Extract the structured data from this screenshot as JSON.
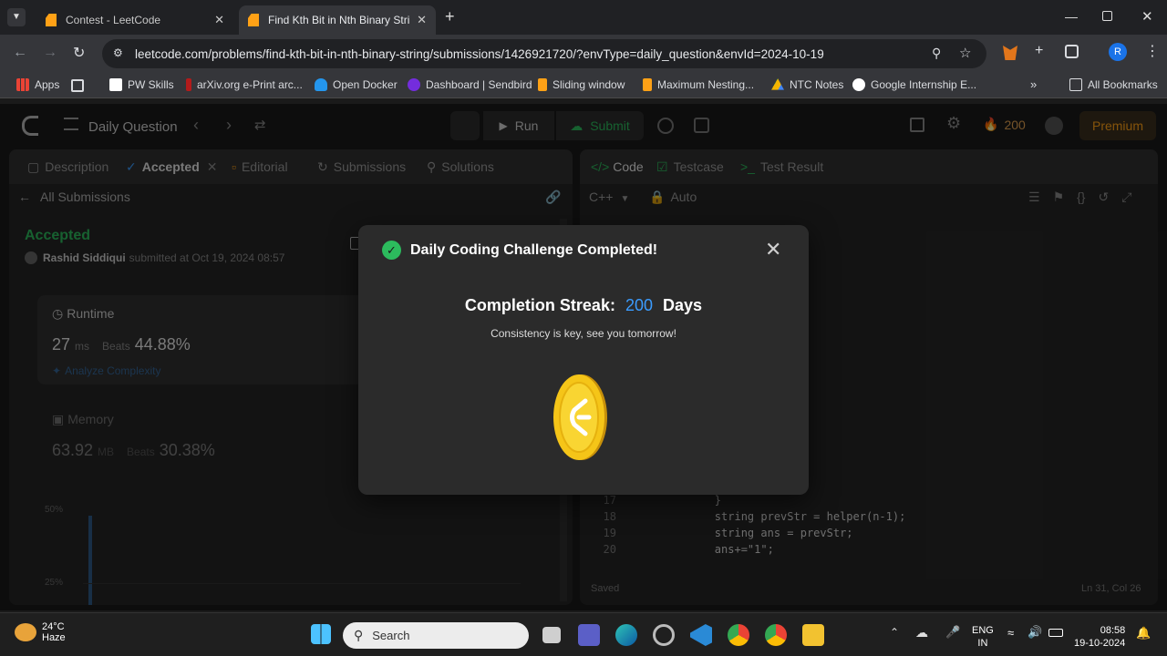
{
  "browser": {
    "tabs": [
      {
        "title": "Contest - LeetCode",
        "active": false
      },
      {
        "title": "Find Kth Bit in Nth Binary String",
        "active": true
      }
    ],
    "url": "leetcode.com/problems/find-kth-bit-in-nth-binary-string/submissions/1426921720/?envType=daily_question&envId=2024-10-19",
    "bookmarks": [
      "Apps",
      "PW Skills",
      "arXiv.org e-Print arc...",
      "Open Docker",
      "Dashboard | Sendbird",
      "Sliding window",
      "Maximum Nesting...",
      "NTC Notes",
      "Google Internship E..."
    ],
    "all_bookmarks": "All Bookmarks",
    "profile_initial": "R"
  },
  "header": {
    "daily_question": "Daily Question",
    "run": "Run",
    "submit": "Submit",
    "streak_count": "200",
    "premium": "Premium"
  },
  "left_panel": {
    "tabs": [
      "Description",
      "Accepted",
      "Editorial",
      "Submissions",
      "Solutions"
    ],
    "all_submissions": "All Submissions",
    "status": "Accepted",
    "author": "Rashid Siddiqui",
    "submitted_text": "submitted at Oct 19, 2024 08:57",
    "runtime_label": "Runtime",
    "runtime_value": "27",
    "runtime_unit": "ms",
    "beats_label": "Beats",
    "runtime_beats": "44.88%",
    "analyze": "Analyze Complexity",
    "memory_label": "Memory",
    "memory_value": "63.92",
    "memory_unit": "MB",
    "memory_beats": "30.38%",
    "axis_50": "50%",
    "axis_25": "25%"
  },
  "right_panel": {
    "tabs": [
      "Code",
      "Testcase",
      "Test Result"
    ],
    "language": "C++",
    "auto": "Auto",
    "code_lines": [
      {
        "n": "17",
        "t": "        }"
      },
      {
        "n": "18",
        "t": "        string prevStr = helper(n-1);"
      },
      {
        "n": "19",
        "t": "        string ans = prevStr;"
      },
      {
        "n": "20",
        "t": "        ans+=\"1\";"
      }
    ],
    "saved": "Saved",
    "cursor": "Ln 31, Col 26"
  },
  "modal": {
    "title": "Daily Coding Challenge Completed!",
    "streak_label": "Completion Streak:",
    "streak_value": "200",
    "streak_unit": "Days",
    "message": "Consistency is key, see you tomorrow!"
  },
  "taskbar": {
    "weather_temp": "24°C",
    "weather_desc": "Haze",
    "search": "Search",
    "lang1": "ENG",
    "lang2": "IN",
    "time": "08:58",
    "date": "19-10-2024"
  },
  "colors": {
    "accent_blue": "#3b9cff",
    "accepted_green": "#2cbb5d",
    "coin_gold": "#f5c518",
    "premium_orange": "#ffa116"
  }
}
